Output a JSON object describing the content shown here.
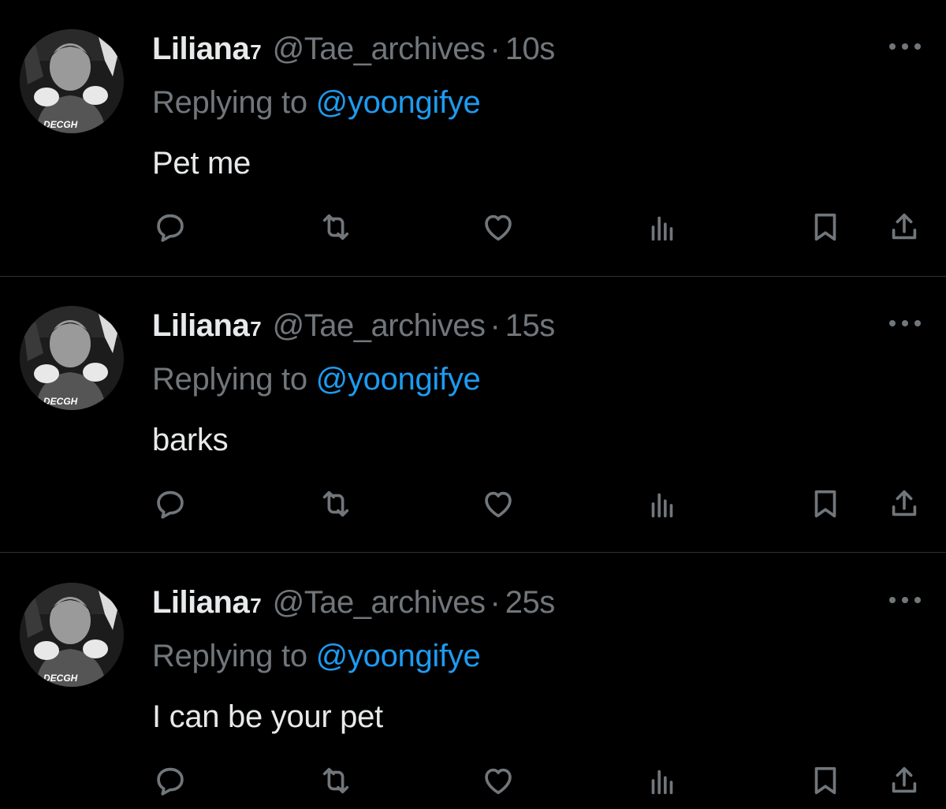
{
  "tweets": [
    {
      "display_name": "Liliana",
      "name_suffix": "7",
      "handle": "@Tae_archives",
      "separator": "·",
      "time": "10s",
      "replying_prefix": "Replying to ",
      "replying_to": "@yoongifye",
      "text": "Pet me",
      "avatar_caption": "DECGH"
    },
    {
      "display_name": "Liliana",
      "name_suffix": "7",
      "handle": "@Tae_archives",
      "separator": "·",
      "time": "15s",
      "replying_prefix": "Replying to ",
      "replying_to": "@yoongifye",
      "text": "barks",
      "avatar_caption": "DECGH"
    },
    {
      "display_name": "Liliana",
      "name_suffix": "7",
      "handle": "@Tae_archives",
      "separator": "·",
      "time": "25s",
      "replying_prefix": "Replying to ",
      "replying_to": "@yoongifye",
      "text": "I can be your pet",
      "avatar_caption": "DECGH"
    }
  ],
  "icons": {
    "reply": "reply-icon",
    "retweet": "retweet-icon",
    "like": "heart-icon",
    "views": "views-icon",
    "bookmark": "bookmark-icon",
    "share": "share-icon",
    "more": "more-icon"
  },
  "colors": {
    "background": "#000000",
    "text": "#e7e9ea",
    "muted": "#71767b",
    "link": "#1d9bf0",
    "divider": "#2f3336"
  }
}
